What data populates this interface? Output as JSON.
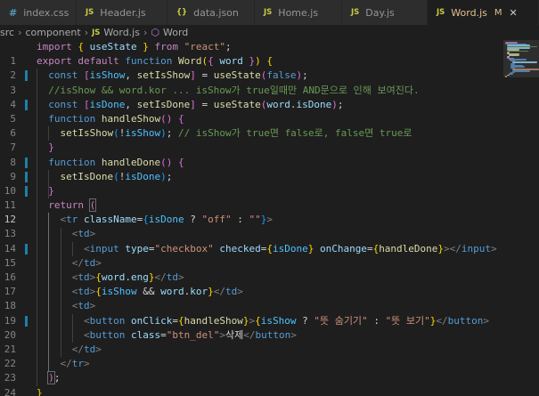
{
  "tabs": [
    {
      "icon": "#",
      "label": "index.css"
    },
    {
      "icon": "JS",
      "label": "Header.js"
    },
    {
      "icon": "{}",
      "label": "data.json"
    },
    {
      "icon": "JS",
      "label": "Home.js"
    },
    {
      "icon": "JS",
      "label": "Day.js"
    },
    {
      "icon": "JS",
      "label": "Word.js",
      "modified": "M",
      "close": "✕"
    }
  ],
  "breadcrumb": {
    "part1": "src",
    "part2": "component",
    "file_icon": "JS",
    "file": "Word.js",
    "symbol": "Word",
    "sep": "›"
  },
  "editor": {
    "line_numbers": [
      "1",
      "2",
      "3",
      "4",
      "5",
      "6",
      "7",
      "8",
      "9",
      "10",
      "11",
      "12",
      "13",
      "14",
      "15",
      "16",
      "17",
      "18",
      "19",
      "20",
      "21",
      "22",
      "23",
      "24",
      "25"
    ],
    "strings": {
      "react": "\"react\"",
      "off": "\"off\"",
      "empty": "\"\"",
      "checkbox": "\"checkbox\"",
      "hide_label": "\"뜻 숨기기\"",
      "show_label": "\"뜻 보기\"",
      "btn_del": "\"btn_del\"",
      "delete_text": "삭제"
    },
    "comments": {
      "line4": "//isShow && word.kor ... isShow가 true일때만 AND문으로 인해 보여진다.",
      "line7": "// isShow가 true면 false로, false면 true로"
    }
  }
}
